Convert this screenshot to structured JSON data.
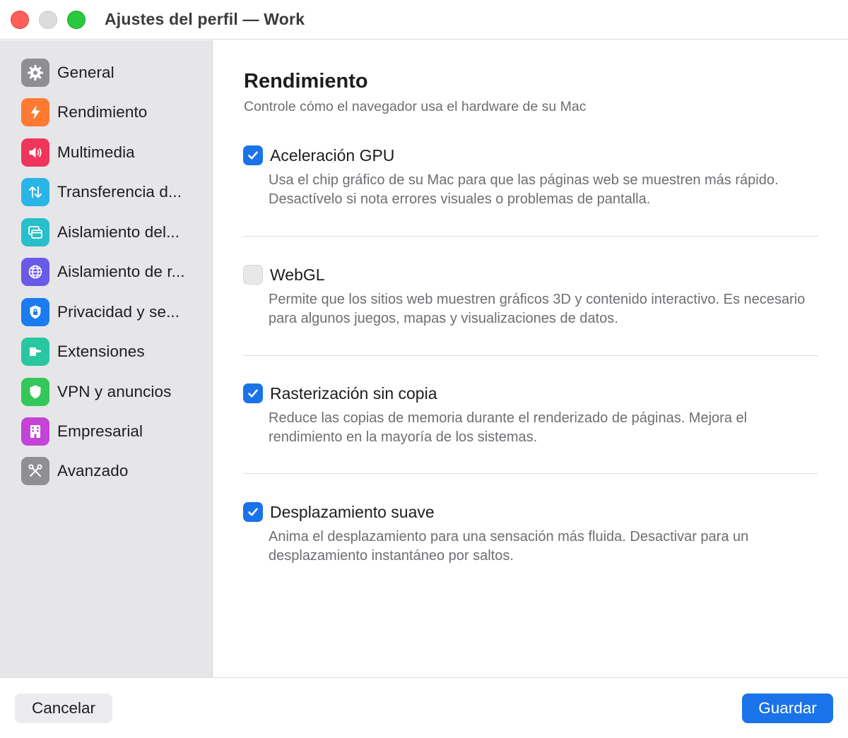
{
  "window": {
    "title": "Ajustes del perfil — Work"
  },
  "sidebar": {
    "items": [
      {
        "label": "General",
        "icon": "gear-icon",
        "color": "#8e8e93"
      },
      {
        "label": "Rendimiento",
        "icon": "bolt-icon",
        "color": "#ff7a30"
      },
      {
        "label": "Multimedia",
        "icon": "speaker-icon",
        "color": "#f0355a"
      },
      {
        "label": "Transferencia d...",
        "icon": "transfer-arrows-icon",
        "color": "#2ab5e8"
      },
      {
        "label": "Aislamiento del...",
        "icon": "window-isolation-icon",
        "color": "#27bfc9"
      },
      {
        "label": "Aislamiento de r...",
        "icon": "globe-icon",
        "color": "#6a5ae8"
      },
      {
        "label": "Privacidad y se...",
        "icon": "lock-shield-icon",
        "color": "#1a7cf0"
      },
      {
        "label": "Extensiones",
        "icon": "puzzle-icon",
        "color": "#28c7a0"
      },
      {
        "label": "VPN y anuncios",
        "icon": "shield-icon",
        "color": "#34c759"
      },
      {
        "label": "Empresarial",
        "icon": "building-icon",
        "color": "#c344d6"
      },
      {
        "label": "Avanzado",
        "icon": "tools-icon",
        "color": "#8e8e93"
      }
    ]
  },
  "main": {
    "title": "Rendimiento",
    "subtitle": "Controle cómo el navegador usa el hardware de su Mac",
    "options": [
      {
        "title": "Aceleración GPU",
        "checked": true,
        "description": "Usa el chip gráfico de su Mac para que las páginas web se muestren más rápido. Desactívelo si nota errores visuales o problemas de pantalla."
      },
      {
        "title": "WebGL",
        "checked": false,
        "description": "Permite que los sitios web muestren gráficos 3D y contenido interactivo. Es necesario para algunos juegos, mapas y visualizaciones de datos."
      },
      {
        "title": "Rasterización sin copia",
        "checked": true,
        "description": "Reduce las copias de memoria durante el renderizado de páginas. Mejora el rendimiento en la mayoría de los sistemas."
      },
      {
        "title": "Desplazamiento suave",
        "checked": true,
        "description": "Anima el desplazamiento para una sensación más fluida. Desactivar para un desplazamiento instantáneo por saltos."
      }
    ]
  },
  "footer": {
    "cancel_label": "Cancelar",
    "save_label": "Guardar"
  }
}
